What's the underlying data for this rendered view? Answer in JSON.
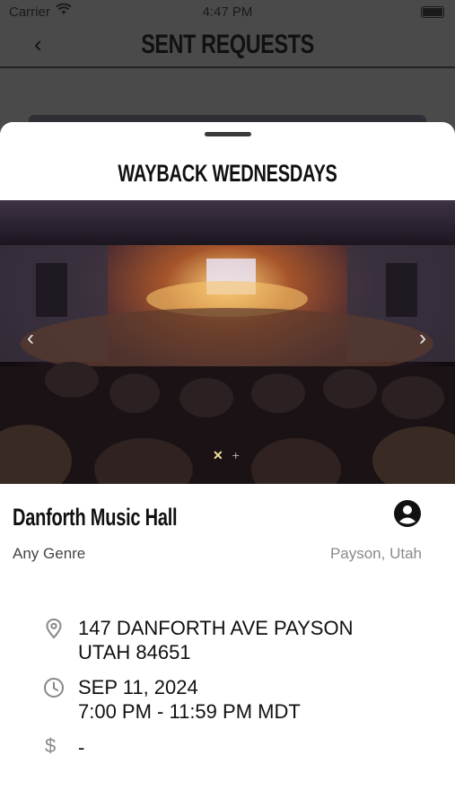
{
  "status_bar": {
    "carrier": "Carrier",
    "time": "4:47 PM"
  },
  "nav": {
    "back_label": "‹",
    "title": "SENT REQUESTS"
  },
  "sheet": {
    "event_title": "WAYBACK WEDNESDAYS",
    "venue_name": "Danforth Music Hall",
    "genre": "Any Genre",
    "location": "Payson, Utah",
    "address_line1": "147 DANFORTH AVE  PAYSON",
    "address_line2": "UTAH 84651",
    "date": "SEP 11, 2024",
    "time_range": "7:00 PM - 11:59 PM MDT",
    "price": "-",
    "carousel": {
      "prev": "‹",
      "next": "›",
      "dot_active": "✕",
      "dot_inactive": "+"
    }
  },
  "icons": {
    "back": "chevron-left-icon",
    "profile": "account-circle-icon",
    "address": "location-pin-icon",
    "time": "clock-icon",
    "price": "dollar-icon"
  },
  "colors": {
    "accent_dark": "#111111",
    "muted": "#8a8a8a",
    "overlay": "#4a4a4a"
  }
}
